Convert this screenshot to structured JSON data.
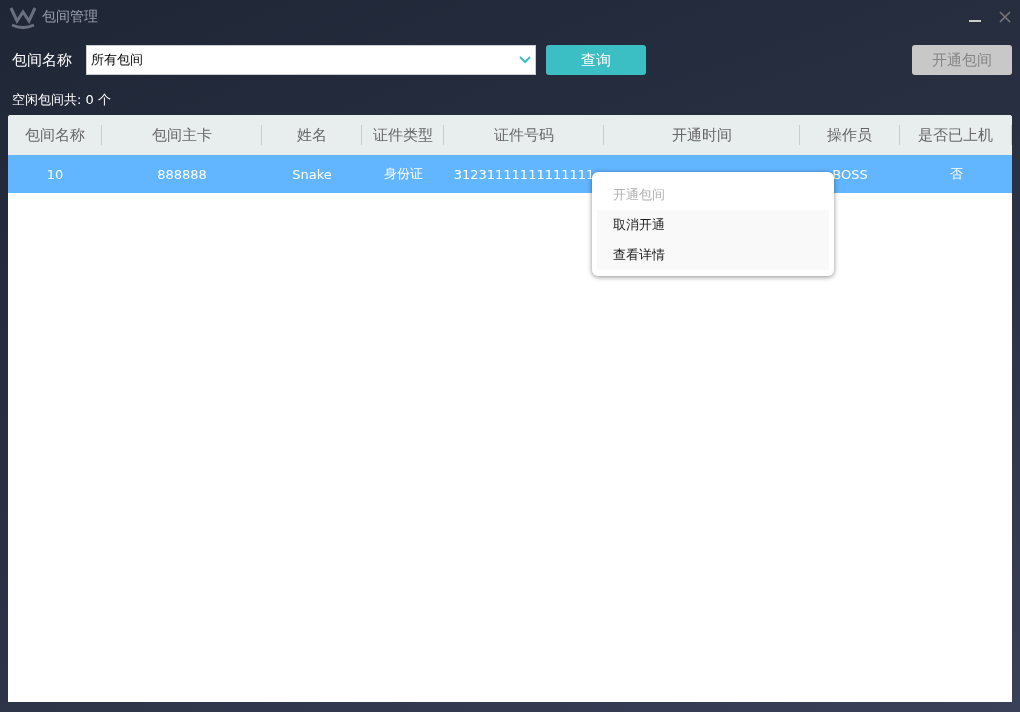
{
  "window": {
    "title": "包间管理"
  },
  "filter": {
    "label": "包间名称",
    "value": "所有包间",
    "search_button": "查询",
    "open_button": {
      "label": "开通包间",
      "disabled": true
    }
  },
  "summary": "空闲包间共: 0 个",
  "table": {
    "columns": [
      "包间名称",
      "包间主卡",
      "姓名",
      "证件类型",
      "证件号码",
      "开通时间",
      "操作员",
      "是否已上机"
    ],
    "rows": [
      {
        "selected": true,
        "cells": [
          "10",
          "888888",
          "Snake",
          "身份证",
          "31231111111111111",
          "",
          "BOSS",
          "否"
        ]
      }
    ]
  },
  "context_menu": [
    {
      "label": "开通包间",
      "disabled": true
    },
    {
      "label": "取消开通",
      "disabled": false
    },
    {
      "label": "查看详情",
      "disabled": false
    }
  ]
}
